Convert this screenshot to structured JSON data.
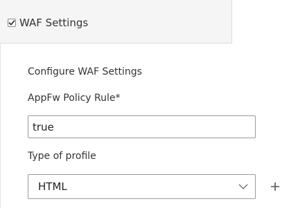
{
  "tab": {
    "title": "WAF Settings",
    "checked": true
  },
  "section": {
    "heading": "Configure WAF Settings"
  },
  "policy_rule": {
    "label": "AppFw Policy Rule*",
    "value": "true"
  },
  "profile_type": {
    "label": "Type of profile",
    "selected": "HTML"
  },
  "icons": {
    "tab_checkbox": "checkbox-checked-icon",
    "dropdown": "chevron-down-icon",
    "add": "plus-icon"
  }
}
